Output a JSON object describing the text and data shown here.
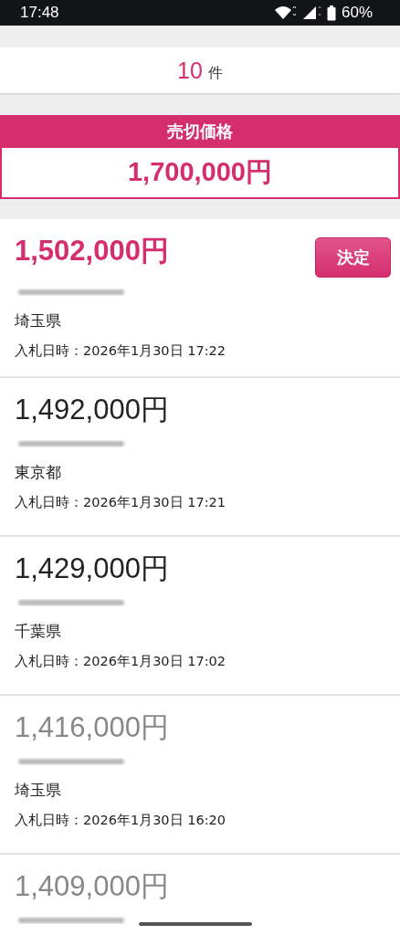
{
  "status_bar": {
    "time": "17:48",
    "battery": "60%"
  },
  "count": {
    "value": "10",
    "unit": "件"
  },
  "sell_price": {
    "label": "売切価格",
    "value": "1,700,000円"
  },
  "bids": [
    {
      "kind": "leader",
      "price": "1,502,000円",
      "button": "決定",
      "location": "埼玉県",
      "bid_time": "入札日時：2026年1月30日 17:22"
    },
    {
      "kind": "normal",
      "price": "1,492,000円",
      "location": "東京都",
      "bid_time": "入札日時：2026年1月30日 17:21"
    },
    {
      "kind": "normal",
      "price": "1,429,000円",
      "location": "千葉県",
      "bid_time": "入札日時：2026年1月30日 17:02"
    },
    {
      "kind": "muted",
      "price": "1,416,000円",
      "location": "埼玉県",
      "bid_time": "入札日時：2026年1月30日 16:20"
    },
    {
      "kind": "muted",
      "price": "1,409,000円"
    }
  ]
}
